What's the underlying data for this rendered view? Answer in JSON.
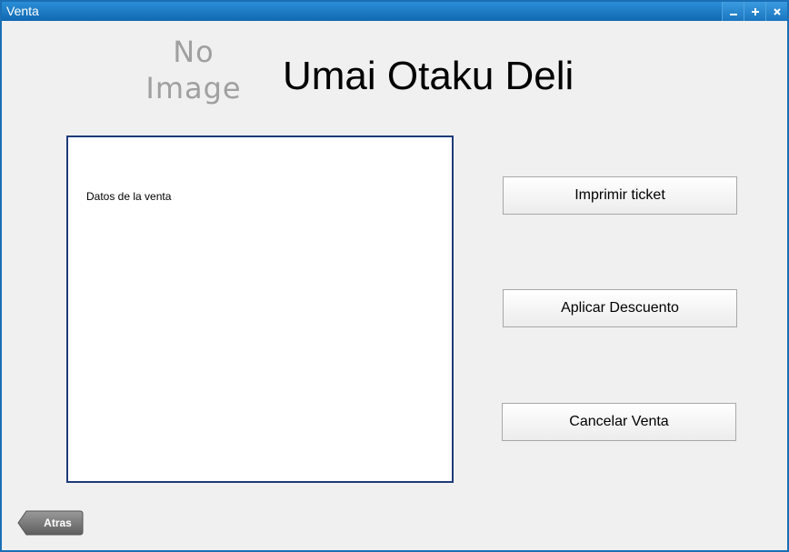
{
  "window": {
    "title": "Venta",
    "controls": [
      {
        "name": "minimize-icon",
        "glyph": "minus"
      },
      {
        "name": "maximize-icon",
        "glyph": "plus"
      },
      {
        "name": "close-icon",
        "glyph": "x"
      }
    ]
  },
  "header": {
    "logo_line1": "No",
    "logo_line2": "Image",
    "app_title": "Umai Otaku Deli"
  },
  "sale_panel": {
    "label": "Datos de la venta"
  },
  "actions": {
    "print_label": "Imprimir ticket",
    "discount_label": "Aplicar Descuento",
    "cancel_label": "Cancelar Venta"
  },
  "footer": {
    "back_label": "Atras"
  },
  "colors": {
    "titlebar": "#1a6fb5",
    "panel_border": "#1f3a7a",
    "back_button": "#6b6b6b"
  }
}
